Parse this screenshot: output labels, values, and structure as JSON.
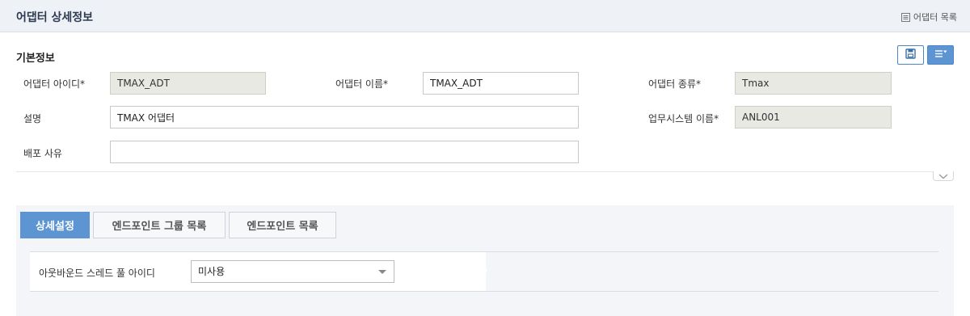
{
  "header": {
    "title": "어댑터 상세정보",
    "list_link": "어댑터 목록"
  },
  "basic_info": {
    "title": "기본정보",
    "fields": {
      "adapter_id": {
        "label": "어댑터 아이디*",
        "value": "TMAX_ADT"
      },
      "adapter_name": {
        "label": "어댑터 이름*",
        "value": "TMAX_ADT"
      },
      "adapter_type": {
        "label": "어댑터 종류*",
        "value": "Tmax"
      },
      "description": {
        "label": "설명",
        "value": "TMAX 어댑터"
      },
      "business_system": {
        "label": "업무시스템 이름*",
        "value": "ANL001"
      },
      "deploy_reason": {
        "label": "배포 사유",
        "value": ""
      }
    }
  },
  "tabs": [
    {
      "label": "상세설정",
      "active": true
    },
    {
      "label": "엔드포인트 그룹 목록",
      "active": false
    },
    {
      "label": "엔드포인트 목록",
      "active": false
    }
  ],
  "detail": {
    "outbound_thread_pool_label": "아웃바운드 스레드 풀 아이디",
    "outbound_thread_pool_value": "미사용"
  },
  "colors": {
    "accent": "#5d95d3",
    "header_bg": "#eef1f6",
    "readonly_bg": "#e9e9e4"
  }
}
